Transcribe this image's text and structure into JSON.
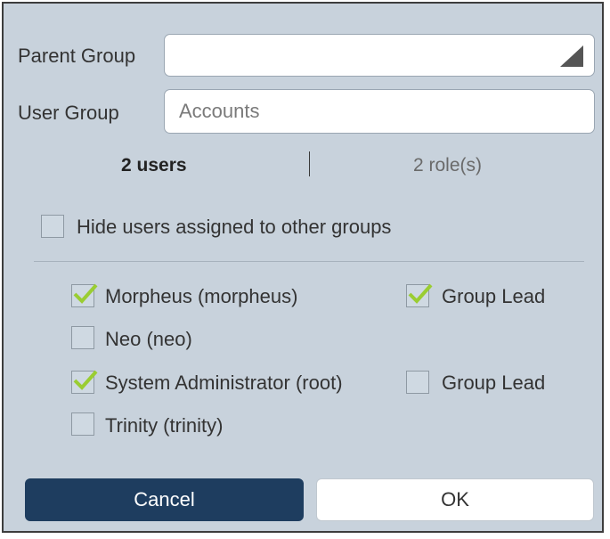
{
  "form": {
    "parent_group_label": "Parent Group",
    "parent_group_value": "",
    "user_group_label": "User Group",
    "user_group_value": "Accounts"
  },
  "tabs": {
    "users": "2 users",
    "roles": "2 role(s)"
  },
  "filter": {
    "hide_assigned_label": "Hide users assigned to other groups",
    "checked": false
  },
  "users": [
    {
      "label": "Morpheus (morpheus)",
      "checked": true,
      "role_label": "Group Lead",
      "role_checked": true
    },
    {
      "label": "Neo (neo)",
      "checked": false
    },
    {
      "label": "System Administrator (root)",
      "checked": true,
      "role_label": "Group Lead",
      "role_checked": false
    },
    {
      "label": "Trinity (trinity)",
      "checked": false
    }
  ],
  "buttons": {
    "cancel": "Cancel",
    "ok": "OK"
  },
  "colors": {
    "dialog_bg": "#c8d2dc",
    "cancel_bg": "#1e3d5f",
    "check_green": "#9acd32"
  }
}
